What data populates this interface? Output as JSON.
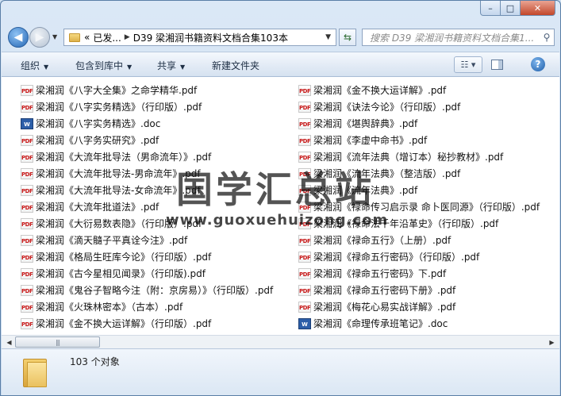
{
  "window": {
    "caption_buttons": [
      "–",
      "□",
      "✕"
    ]
  },
  "nav": {
    "address_overflow": "«",
    "address_segments": [
      "已发...",
      "D39 梁湘润书籍资料文档合集103本"
    ],
    "search_placeholder": "搜索 D39 梁湘润书籍资料文档合集1..."
  },
  "toolbar": {
    "organize": "组织",
    "include_in_library": "包含到库中",
    "share": "共享",
    "new_folder": "新建文件夹"
  },
  "files_left": [
    {
      "type": "pdf",
      "name": "梁湘润《八字大全集》之命学精华.pdf"
    },
    {
      "type": "pdf",
      "name": "梁湘润《八字实务精选》（行印版）.pdf"
    },
    {
      "type": "doc",
      "name": "梁湘润《八字实务精选》.doc"
    },
    {
      "type": "pdf",
      "name": "梁湘润《八字务实研究》.pdf"
    },
    {
      "type": "pdf",
      "name": "梁湘润《大流年批导法（男命流年）》.pdf"
    },
    {
      "type": "pdf",
      "name": "梁湘润《大流年批导法-男命流年》.pdf"
    },
    {
      "type": "pdf",
      "name": "梁湘润《大流年批导法-女命流年》.pdf"
    },
    {
      "type": "pdf",
      "name": "梁湘润《大流年批道法》.pdf"
    },
    {
      "type": "pdf",
      "name": "梁湘润《大衍易数表隐》（行印版）.pdf"
    },
    {
      "type": "pdf",
      "name": "梁湘润《滴天髓子平真诠今注》.pdf"
    },
    {
      "type": "pdf",
      "name": "梁湘润《格局生旺库今论》（行印版）.pdf"
    },
    {
      "type": "pdf",
      "name": "梁湘润《古今星相见闻录》（行印版).pdf"
    },
    {
      "type": "pdf",
      "name": "梁湘润《鬼谷子智略今注（附：京房易）》（行印版）.pdf"
    },
    {
      "type": "pdf",
      "name": "梁湘润《火珠林密本》（古本）.pdf"
    },
    {
      "type": "pdf",
      "name": "梁湘润《金不换大运详解》（行印版）.pdf"
    }
  ],
  "files_right": [
    {
      "type": "pdf",
      "name": "梁湘润《金不换大运详解》.pdf"
    },
    {
      "type": "pdf",
      "name": "梁湘润《诀法今论》（行印版）.pdf"
    },
    {
      "type": "pdf",
      "name": "梁湘润《堪舆辞典》.pdf"
    },
    {
      "type": "pdf",
      "name": "梁湘润《李虚中命书》.pdf"
    },
    {
      "type": "pdf",
      "name": "梁湘润《流年法典（增订本）秘抄教材》.pdf"
    },
    {
      "type": "pdf",
      "name": "梁湘润《流年法典》（整洁版）.pdf"
    },
    {
      "type": "pdf",
      "name": "梁湘润《流年法典》.pdf"
    },
    {
      "type": "pdf",
      "name": "梁湘润《禄命传习启示录 命卜医同源》（行印版）.pdf"
    },
    {
      "type": "pdf",
      "name": "梁湘润《禄命法千年沿革史》（行印版）.pdf"
    },
    {
      "type": "pdf",
      "name": "梁湘润《禄命五行》（上册）.pdf"
    },
    {
      "type": "pdf",
      "name": "梁湘润《禄命五行密码》（行印版）.pdf"
    },
    {
      "type": "pdf",
      "name": "梁湘润《禄命五行密码》下.pdf"
    },
    {
      "type": "pdf",
      "name": "梁湘润《禄命五行密码下册》.pdf"
    },
    {
      "type": "pdf",
      "name": "梁湘润《梅花心易实战详解》.pdf"
    },
    {
      "type": "doc",
      "name": "梁湘润《命理传承班笔记》.doc"
    }
  ],
  "watermark": {
    "title": "国学汇总站",
    "url": "www.guoxuehuizong.com"
  },
  "status": {
    "item_count": "103 个对象"
  }
}
